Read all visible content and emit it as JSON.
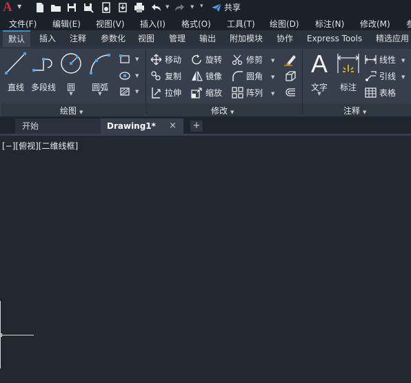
{
  "app": {
    "logo": "A",
    "share_label": "共享"
  },
  "menu": [
    "文件(F)",
    "编辑(E)",
    "视图(V)",
    "插入(I)",
    "格式(O)",
    "工具(T)",
    "绘图(D)",
    "标注(N)",
    "修改(M)",
    "参"
  ],
  "ribbon_tabs": [
    "默认",
    "插入",
    "注释",
    "参数化",
    "视图",
    "管理",
    "输出",
    "附加模块",
    "协作",
    "Express Tools",
    "精选应用"
  ],
  "panels": {
    "draw": {
      "title": "绘图",
      "buttons": {
        "line": "直线",
        "polyline": "多段线",
        "circle": "圆",
        "arc": "圆弧"
      }
    },
    "modify": {
      "title": "修改",
      "buttons": {
        "move": "移动",
        "rotate": "旋转",
        "trim": "修剪",
        "copy": "复制",
        "mirror": "镜像",
        "fillet": "圆角",
        "stretch": "拉伸",
        "scale": "缩放",
        "array": "阵列"
      }
    },
    "annotation": {
      "title": "注释",
      "buttons": {
        "text": "文字",
        "dimension": "标注",
        "linear": "线性",
        "leader": "引线",
        "table": "表格"
      },
      "text_glyph": "A"
    }
  },
  "doc_tabs": {
    "start": "开始",
    "active": "Drawing1*",
    "close": "×",
    "add": "+"
  },
  "viewport": {
    "label": "[−][俯视][二维线框]"
  },
  "colors": {
    "accent": "#3e8fd1",
    "logo": "#d7263d",
    "background": "#212830"
  }
}
